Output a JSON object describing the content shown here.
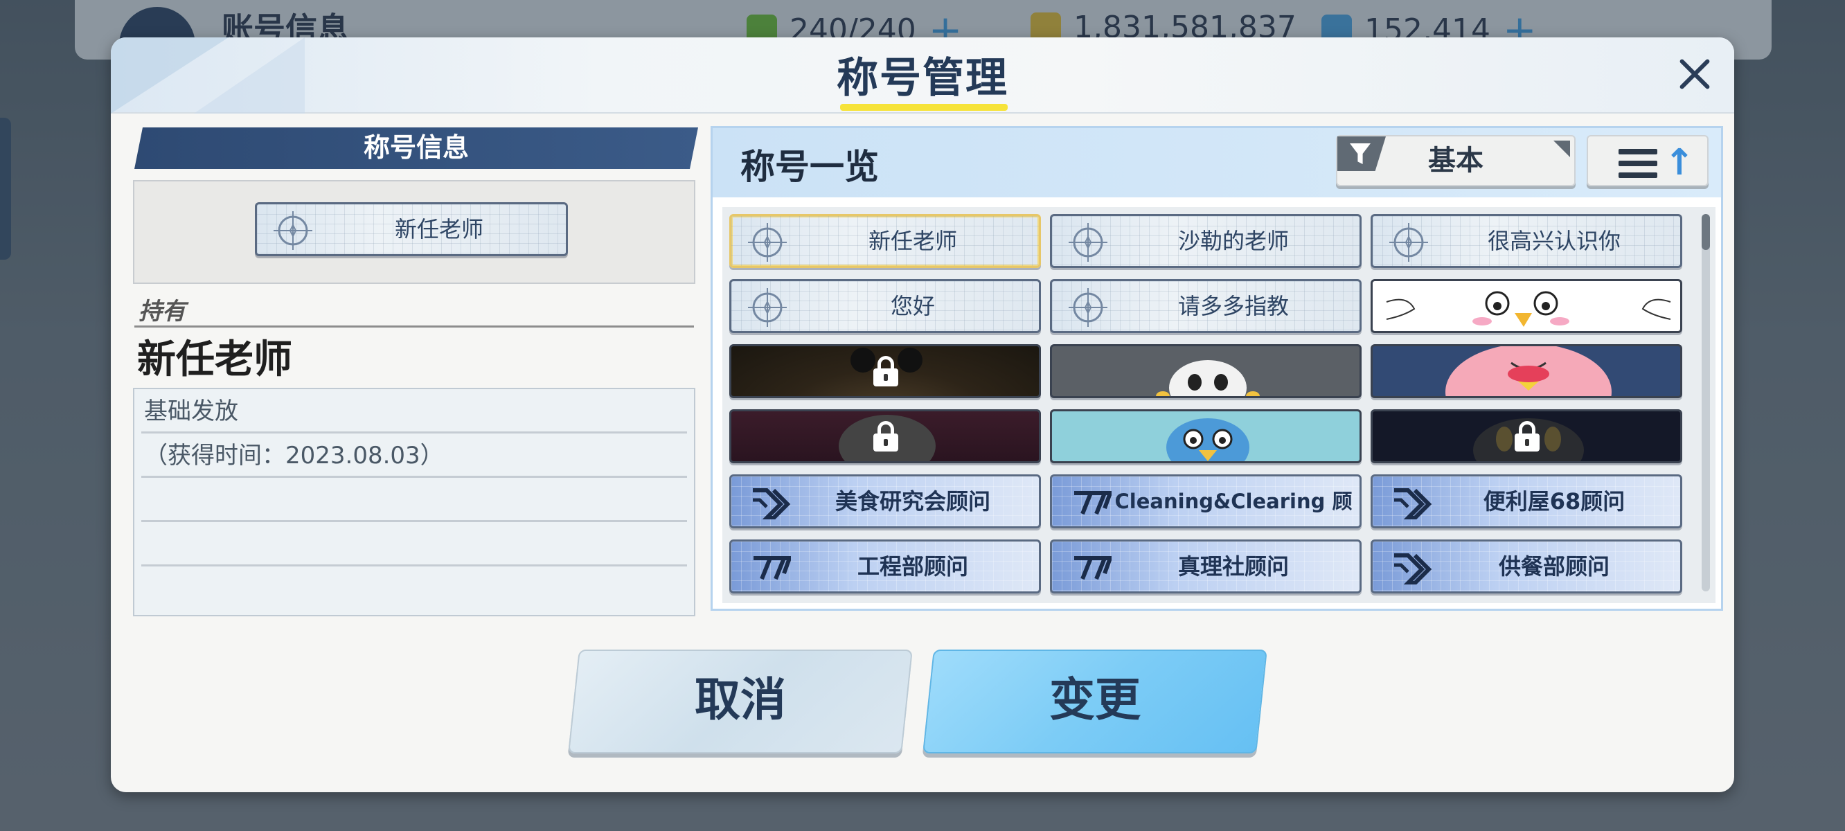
{
  "background": {
    "title": "账号信息",
    "stamina": "240/240",
    "credits": "1,831,581,837",
    "gems": "152,414"
  },
  "dialog": {
    "title": "称号管理",
    "left": {
      "header": "称号信息",
      "preview_label": "新任老师",
      "owned_label": "持有",
      "owned_name": "新任老师",
      "info_rows": [
        "基础发放",
        "（获得时间：2023.08.03）",
        "",
        ""
      ]
    },
    "right": {
      "header": "称号一览",
      "filter_label": "基本"
    },
    "titles": [
      {
        "label": "新任老师",
        "style": "text",
        "selected": true
      },
      {
        "label": "沙勒的老师",
        "style": "text"
      },
      {
        "label": "很高兴认识你",
        "style": "text"
      },
      {
        "label": "您好",
        "style": "text"
      },
      {
        "label": "请多多指教",
        "style": "text"
      },
      {
        "label": "",
        "style": "image-white"
      },
      {
        "label": "",
        "style": "image-locked"
      },
      {
        "label": "",
        "style": "image-gray"
      },
      {
        "label": "",
        "style": "image-navy"
      },
      {
        "label": "",
        "style": "image-locked-maroon"
      },
      {
        "label": "",
        "style": "image-cyan"
      },
      {
        "label": "",
        "style": "image-locked-black"
      },
      {
        "label": "美食研究会顾问",
        "style": "badge",
        "icon": "chevron-emblem-icon"
      },
      {
        "label": "Cleaning&Clearing 顾问",
        "style": "badge",
        "icon": "stripe-emblem-icon"
      },
      {
        "label": "便利屋68顾问",
        "style": "badge",
        "icon": "chevron-emblem-icon"
      },
      {
        "label": "工程部顾问",
        "style": "badge",
        "icon": "stripe-emblem-icon"
      },
      {
        "label": "真理社顾问",
        "style": "badge",
        "icon": "stripe-emblem-icon"
      },
      {
        "label": "供餐部顾问",
        "style": "badge",
        "icon": "chevron-emblem-icon"
      }
    ],
    "buttons": {
      "cancel": "取消",
      "change": "变更"
    }
  },
  "colors": {
    "accent_yellow": "#f6e33a",
    "primary_blue": "#7cccf6",
    "header_navy": "#2e4a73"
  }
}
